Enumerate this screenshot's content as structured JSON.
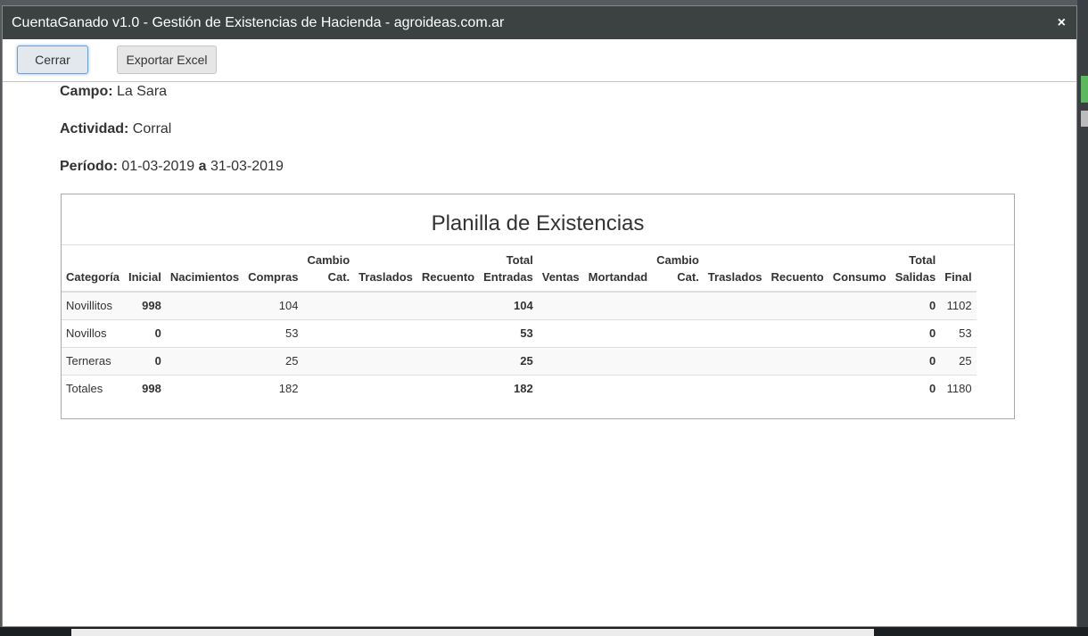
{
  "window": {
    "title": "CuentaGanado v1.0 - Gestión de Existencias de Hacienda - agroideas.com.ar",
    "close_icon": "×"
  },
  "buttons": {
    "cerrar": "Cerrar",
    "exportar": "Exportar Excel"
  },
  "info": {
    "campo_label": "Campo:",
    "campo_value": "La Sara",
    "actividad_label": "Actividad:",
    "actividad_value": "Corral",
    "periodo_label": "Período:",
    "periodo_from": "01-03-2019",
    "periodo_sep": "a",
    "periodo_to": "31-03-2019"
  },
  "panel": {
    "title": "Planilla de Existencias",
    "headers": [
      "Categoría",
      "Inicial",
      "Nacimientos",
      "Compras",
      "Cambio Cat.",
      "Traslados",
      "Recuento",
      "Total Entradas",
      "Ventas",
      "Mortandad",
      "Cambio Cat.",
      "Traslados",
      "Recuento",
      "Consumo",
      "Total Salidas",
      "Final"
    ],
    "headers_line1": [
      "",
      "",
      "",
      "",
      "Cambio",
      "",
      "",
      "Total",
      "",
      "",
      "Cambio",
      "",
      "",
      "",
      "Total",
      ""
    ],
    "headers_line2": [
      "Categoría",
      "Inicial",
      "Nacimientos",
      "Compras",
      "Cat.",
      "Traslados",
      "Recuento",
      "Entradas",
      "Ventas",
      "Mortandad",
      "Cat.",
      "Traslados",
      "Recuento",
      "Consumo",
      "Salidas",
      "Final"
    ],
    "rows": [
      [
        "Novillitos",
        "998",
        "",
        "104",
        "",
        "",
        "",
        "104",
        "",
        "",
        "",
        "",
        "",
        "",
        "0",
        "1102"
      ],
      [
        "Novillos",
        "0",
        "",
        "53",
        "",
        "",
        "",
        "53",
        "",
        "",
        "",
        "",
        "",
        "",
        "0",
        "53"
      ],
      [
        "Terneras",
        "0",
        "",
        "25",
        "",
        "",
        "",
        "25",
        "",
        "",
        "",
        "",
        "",
        "",
        "0",
        "25"
      ],
      [
        "Totales",
        "998",
        "",
        "182",
        "",
        "",
        "",
        "182",
        "",
        "",
        "",
        "",
        "",
        "",
        "0",
        "1180"
      ]
    ]
  },
  "colors": {
    "titlebar": "#3c4242",
    "button_focus_border": "#6e9fd6"
  }
}
